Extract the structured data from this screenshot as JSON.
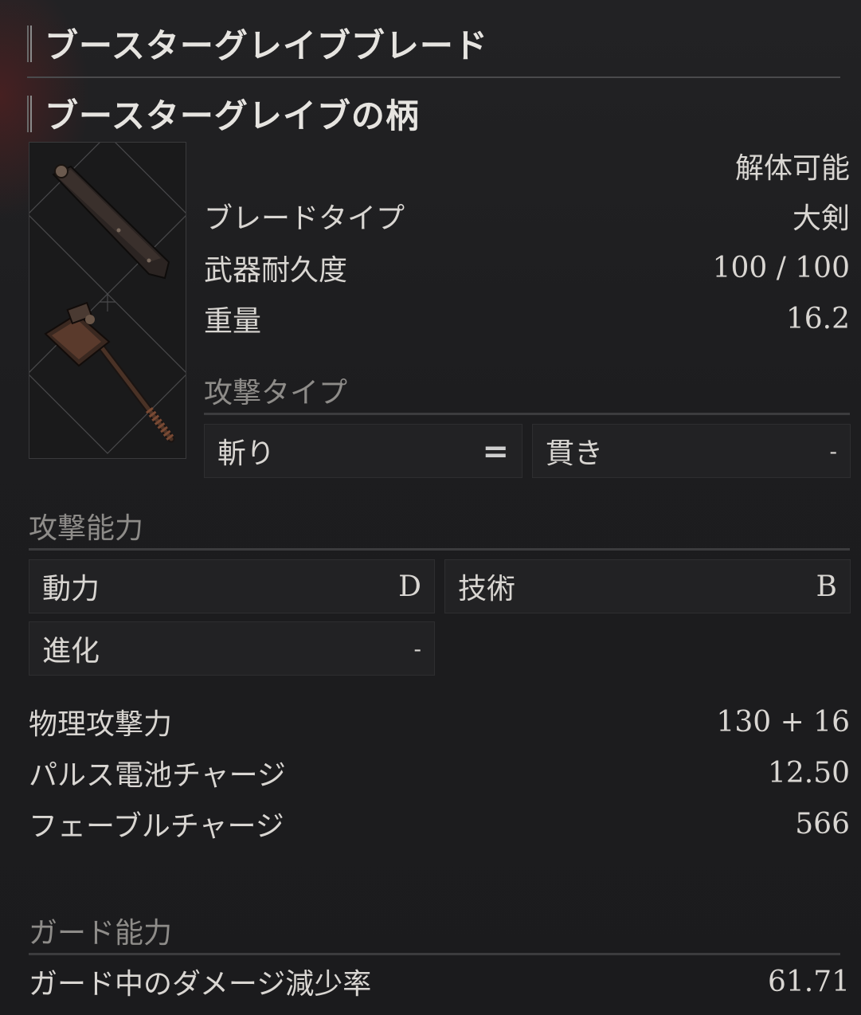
{
  "weapon": {
    "name": "ブースターグレイブブレード",
    "handle_name": "ブースターグレイブの柄",
    "dismantle": "解体可能"
  },
  "info": [
    {
      "label": "ブレードタイプ",
      "value": "大剣"
    },
    {
      "label": "武器耐久度",
      "value": "100 / 100"
    },
    {
      "label": "重量",
      "value": "16.2"
    }
  ],
  "attack_type": {
    "label": "攻撃タイプ",
    "slash": {
      "label": "斬り",
      "value": "="
    },
    "pierce": {
      "label": "貫き",
      "value": "-"
    }
  },
  "attack_ability": {
    "label": "攻撃能力",
    "power": {
      "label": "動力",
      "value": "D"
    },
    "technique": {
      "label": "技術",
      "value": "B"
    },
    "advance": {
      "label": "進化",
      "value": "-"
    }
  },
  "stats": [
    {
      "label": "物理攻撃力",
      "value": "130 + 16"
    },
    {
      "label": "パルス電池チャージ",
      "value": "12.50"
    },
    {
      "label": "フェーブルチャージ",
      "value": "566"
    }
  ],
  "guard": {
    "label": "ガード能力",
    "reduction": {
      "label": "ガード中のダメージ減少率",
      "value": "61.71"
    }
  }
}
